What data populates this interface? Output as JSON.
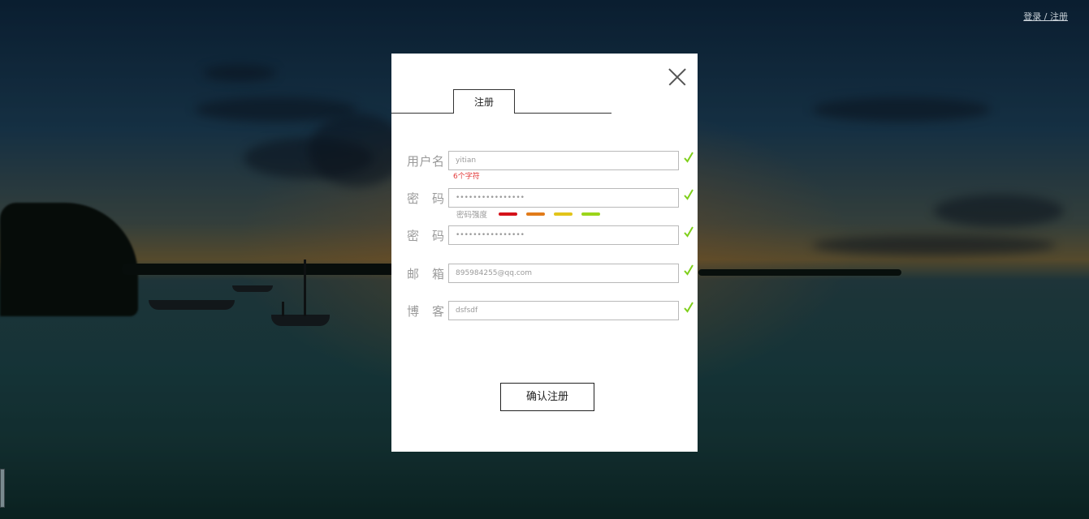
{
  "header": {
    "auth_link": "登录 / 注册"
  },
  "modal": {
    "tab_label": "注册",
    "fields": [
      {
        "label": "用户名",
        "value": "yitian",
        "hint": "6个字符"
      },
      {
        "label": "密 码",
        "value": "••••••••••••••••"
      },
      {
        "label": "密 码",
        "value": "••••••••••••••••"
      },
      {
        "label": "邮 箱",
        "value": "895984255@qq.com"
      },
      {
        "label": "博 客",
        "value": "dsfsdf"
      }
    ],
    "strength": {
      "label": "密码强度",
      "colors": [
        "#d4121a",
        "#e17b1a",
        "#e2c41a",
        "#9bd51a"
      ]
    },
    "check_color": "#7fcf1b",
    "submit_label": "确认注册"
  }
}
